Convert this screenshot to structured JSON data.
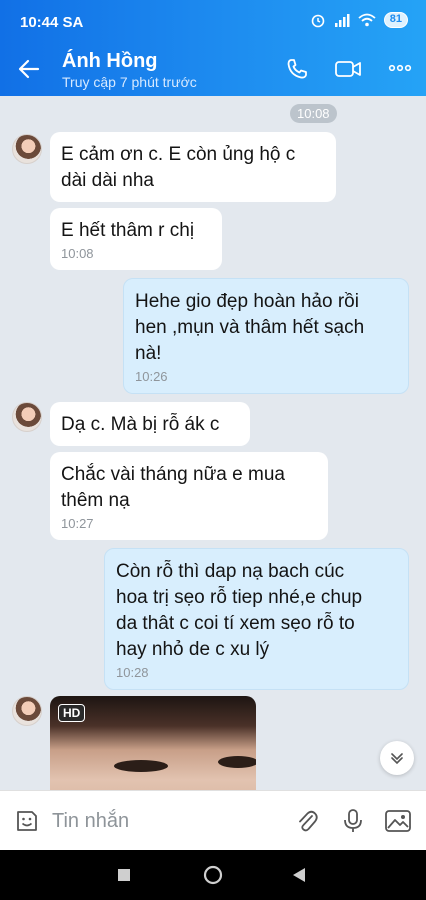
{
  "status_bar": {
    "time": "10:44 SA",
    "battery": "81"
  },
  "header": {
    "contact_name": "Ánh Hồng",
    "last_seen": "Truy cập 7 phút trước"
  },
  "chat": {
    "date_stamp": "10:08",
    "messages": [
      {
        "side": "in",
        "text_lines": [
          "E cảm ơn c. E còn ủng hộ c",
          "dài dài nha"
        ],
        "time": ""
      },
      {
        "side": "in",
        "text_lines": [
          "E hết thâm r chị"
        ],
        "time": "10:08"
      },
      {
        "side": "out",
        "text_lines": [
          "Hehe gio đẹp hoàn hảo rồi",
          "hen ,mụn và thâm hết sạch",
          "nà!"
        ],
        "time": "10:26"
      },
      {
        "side": "in",
        "text_lines": [
          "Dạ c. Mà bị rỗ ák c"
        ],
        "time": ""
      },
      {
        "side": "in",
        "text_lines": [
          "Chắc vài tháng nữa e mua",
          "thêm nạ"
        ],
        "time": "10:27"
      },
      {
        "side": "out",
        "text_lines": [
          "Còn rỗ thì dap nạ bach cúc",
          "hoa trị sẹo rỗ tiep nhé,e chup",
          "da thât c coi tí xem sẹo rỗ to",
          "hay nhỏ de c xu lý"
        ],
        "time": "10:28"
      }
    ],
    "photo_badge": "HD"
  },
  "composer": {
    "placeholder": "Tin nhắn"
  },
  "icons": [
    "back-arrow-icon",
    "phone-icon",
    "video-call-icon",
    "more-icon",
    "sticker-icon",
    "attach-icon",
    "mic-icon",
    "image-icon",
    "chevron-down-icon"
  ],
  "colors": {
    "accent": "#1e8df0",
    "outgoing_bubble": "#d8eefd",
    "incoming_bubble": "#ffffff",
    "background": "#e3e8ee"
  }
}
